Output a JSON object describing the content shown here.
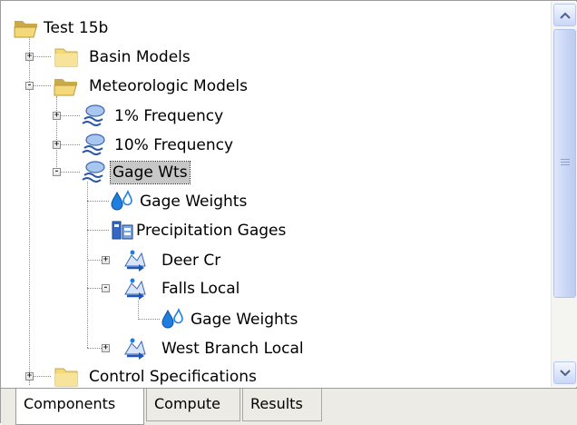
{
  "tree": {
    "root": {
      "label": "Test 15b",
      "icon": "open-folder-icon"
    },
    "nodes": [
      {
        "label": "Basin Models",
        "icon": "folder-icon",
        "expander": "+"
      },
      {
        "label": "Meteorologic Models",
        "icon": "open-folder-icon",
        "expander": "-"
      },
      {
        "label": "1% Frequency",
        "icon": "meteorologic-model-icon",
        "expander": "+"
      },
      {
        "label": "10% Frequency",
        "icon": "meteorologic-model-icon",
        "expander": "+"
      },
      {
        "label": "Gage Wts",
        "icon": "meteorologic-model-icon",
        "expander": "-",
        "selected": true
      },
      {
        "label": "Gage Weights",
        "icon": "gage-weights-icon"
      },
      {
        "label": "Precipitation Gages",
        "icon": "precipitation-gages-icon"
      },
      {
        "label": "Deer Cr",
        "icon": "subbasin-icon",
        "expander": "+"
      },
      {
        "label": "Falls Local",
        "icon": "subbasin-icon",
        "expander": "-"
      },
      {
        "label": "Gage Weights",
        "icon": "gage-weights-icon"
      },
      {
        "label": "West Branch Local",
        "icon": "subbasin-icon",
        "expander": "+"
      },
      {
        "label": "Control Specifications",
        "icon": "folder-icon",
        "expander": "+"
      }
    ]
  },
  "tabs": [
    {
      "label": "Components",
      "active": true
    },
    {
      "label": "Compute",
      "active": false
    },
    {
      "label": "Results",
      "active": false
    }
  ],
  "colors": {
    "folder": "#f3d97a",
    "selection": "#c7c7c7",
    "water_drop": "#1e7fe0",
    "scroll_button": "#c9d6f6"
  }
}
